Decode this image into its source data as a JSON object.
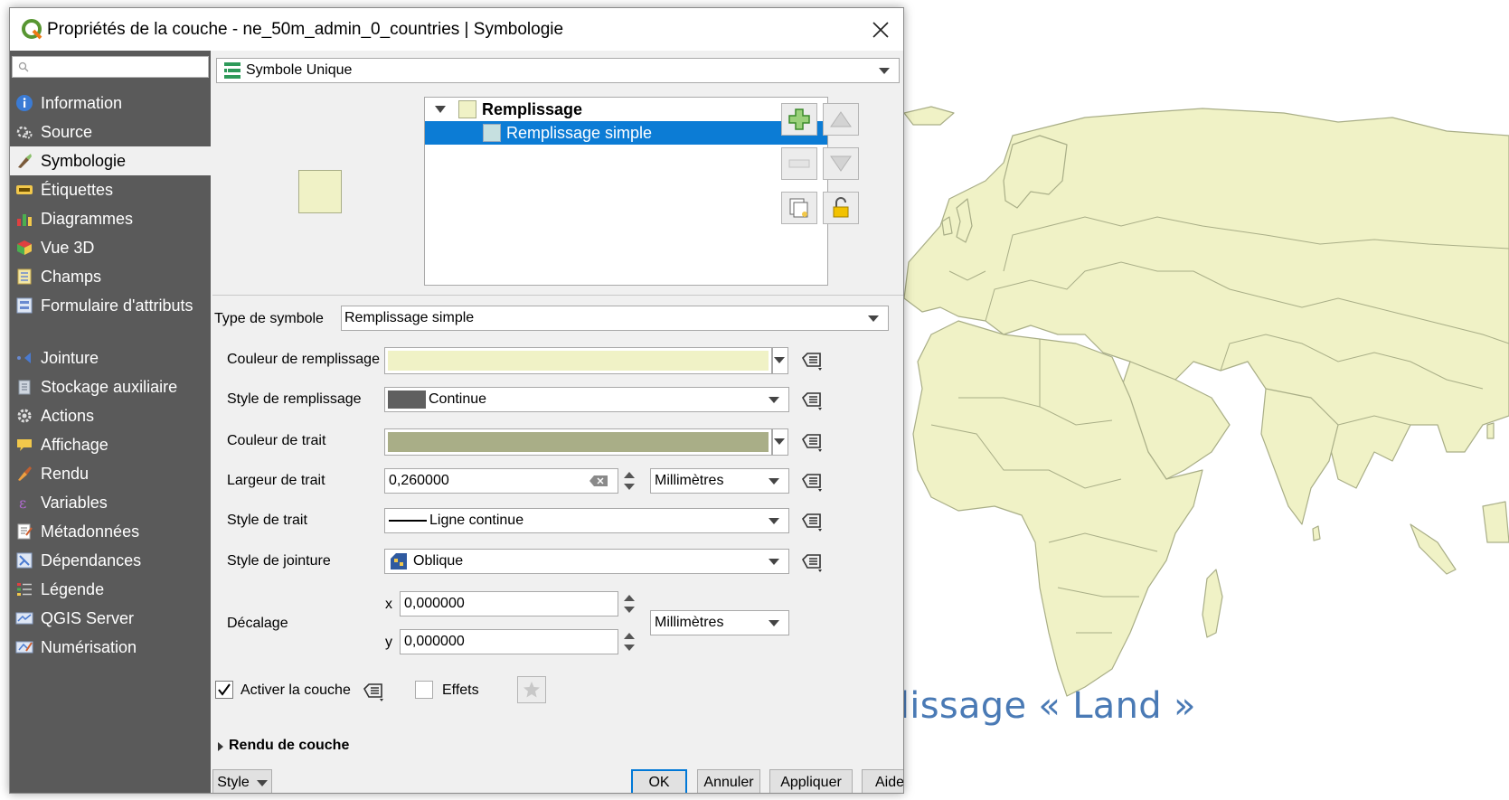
{
  "window": {
    "title": "Propriétés de la couche - ne_50m_admin_0_countries | Symbologie"
  },
  "colors": {
    "fill": "#f0f2c6",
    "stroke": "#a9ae87",
    "selection": "#0c7cd5",
    "sidebar": "#5a5a5a",
    "caption": "#4a7ab5"
  },
  "sidebar": {
    "search_placeholder": "",
    "items": [
      {
        "label": "Information",
        "icon": "info-icon"
      },
      {
        "label": "Source",
        "icon": "source-icon"
      },
      {
        "label": "Symbologie",
        "icon": "symbology-brush-icon",
        "active": true
      },
      {
        "label": "Étiquettes",
        "icon": "labels-abc-icon"
      },
      {
        "label": "Diagrammes",
        "icon": "diagram-icon"
      },
      {
        "label": "Vue 3D",
        "icon": "cube-3d-icon"
      },
      {
        "label": "Champs",
        "icon": "fields-icon"
      },
      {
        "label": "Formulaire d'attributs",
        "icon": "form-icon"
      },
      {
        "label": "Jointure",
        "icon": "join-icon"
      },
      {
        "label": "Stockage auxiliaire",
        "icon": "auxiliary-storage-icon"
      },
      {
        "label": "Actions",
        "icon": "actions-gear-icon"
      },
      {
        "label": "Affichage",
        "icon": "display-tooltip-icon"
      },
      {
        "label": "Rendu",
        "icon": "render-brush-icon"
      },
      {
        "label": "Variables",
        "icon": "variables-icon"
      },
      {
        "label": "Métadonnées",
        "icon": "metadata-icon"
      },
      {
        "label": "Dépendances",
        "icon": "dependencies-icon"
      },
      {
        "label": "Légende",
        "icon": "legend-icon"
      },
      {
        "label": "QGIS Server",
        "icon": "qgis-server-icon"
      },
      {
        "label": "Numérisation",
        "icon": "digitizing-icon"
      }
    ]
  },
  "renderer": {
    "type": "Symbole Unique"
  },
  "symbol_tree": {
    "root": "Remplissage",
    "child": "Remplissage simple"
  },
  "symbol_type": {
    "label": "Type de symbole",
    "value": "Remplissage simple"
  },
  "fields": {
    "fill_color": {
      "label": "Couleur de remplissage"
    },
    "fill_style": {
      "label": "Style de remplissage",
      "value": "Continue"
    },
    "stroke_color": {
      "label": "Couleur de trait"
    },
    "stroke_width": {
      "label": "Largeur de trait",
      "value": "0,260000",
      "unit": "Millimètres"
    },
    "stroke_style": {
      "label": "Style de trait",
      "value": "Ligne continue"
    },
    "join_style": {
      "label": "Style de jointure",
      "value": "Oblique"
    },
    "offset": {
      "label": "Décalage",
      "x_label": "x",
      "x": "0,000000",
      "y_label": "y",
      "y": "0,000000",
      "unit": "Millimètres"
    }
  },
  "enable_layer": {
    "label": "Activer la couche",
    "checked": true
  },
  "effects": {
    "label": "Effets",
    "checked": false
  },
  "layer_rendering": {
    "label": "Rendu de couche"
  },
  "buttons": {
    "style": "Style",
    "ok": "OK",
    "cancel": "Annuler",
    "apply": "Appliquer",
    "help": "Aide"
  },
  "caption": "Symbole Remplissage « Land »"
}
